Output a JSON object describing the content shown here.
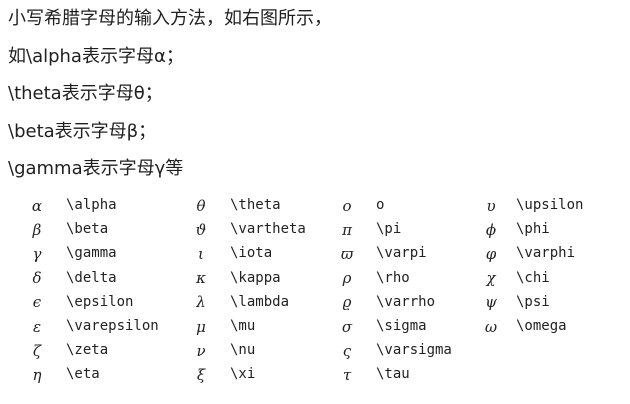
{
  "intro": {
    "lines": [
      "小写希腊字母的输入方法，如右图所示，",
      "如\\alpha表示字母α；",
      "\\theta表示字母θ；",
      "\\beta表示字母β；",
      "\\gamma表示字母γ等"
    ]
  },
  "greek_table": {
    "rows": [
      [
        "α",
        "\\alpha",
        "θ",
        "\\theta",
        "o",
        "o",
        "υ",
        "\\upsilon"
      ],
      [
        "β",
        "\\beta",
        "ϑ",
        "\\vartheta",
        "π",
        "\\pi",
        "ϕ",
        "\\phi"
      ],
      [
        "γ",
        "\\gamma",
        "ι",
        "\\iota",
        "ϖ",
        "\\varpi",
        "φ",
        "\\varphi"
      ],
      [
        "δ",
        "\\delta",
        "κ",
        "\\kappa",
        "ρ",
        "\\rho",
        "χ",
        "\\chi"
      ],
      [
        "ϵ",
        "\\epsilon",
        "λ",
        "\\lambda",
        "ϱ",
        "\\varrho",
        "ψ",
        "\\psi"
      ],
      [
        "ε",
        "\\varepsilon",
        "μ",
        "\\mu",
        "σ",
        "\\sigma",
        "ω",
        "\\omega"
      ],
      [
        "ζ",
        "\\zeta",
        "ν",
        "\\nu",
        "ς",
        "\\varsigma",
        "",
        ""
      ],
      [
        "η",
        "\\eta",
        "ξ",
        "\\xi",
        "τ",
        "\\tau",
        "",
        ""
      ]
    ]
  }
}
